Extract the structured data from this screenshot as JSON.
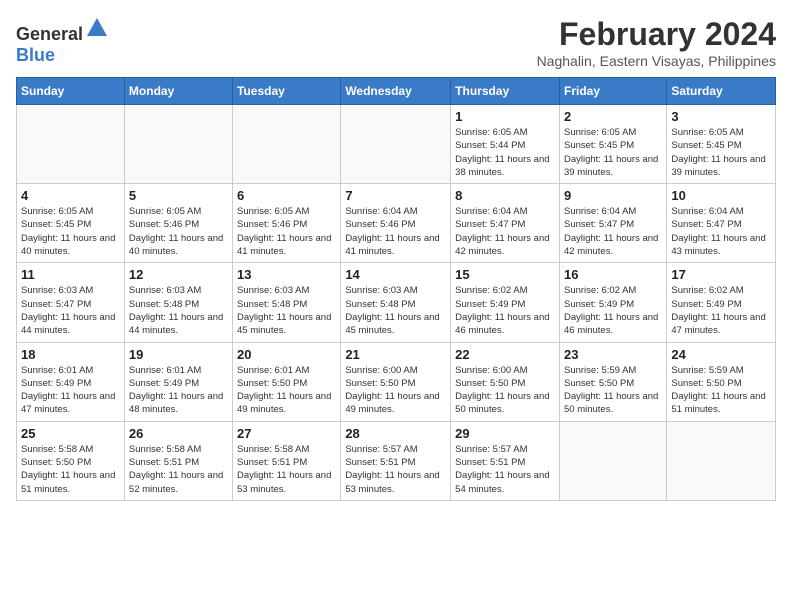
{
  "logo": {
    "text_general": "General",
    "text_blue": "Blue"
  },
  "title": {
    "month_year": "February 2024",
    "location": "Naghalin, Eastern Visayas, Philippines"
  },
  "weekdays": [
    "Sunday",
    "Monday",
    "Tuesday",
    "Wednesday",
    "Thursday",
    "Friday",
    "Saturday"
  ],
  "weeks": [
    [
      {
        "day": "",
        "sunrise": "",
        "sunset": "",
        "daylight": "",
        "empty": true
      },
      {
        "day": "",
        "sunrise": "",
        "sunset": "",
        "daylight": "",
        "empty": true
      },
      {
        "day": "",
        "sunrise": "",
        "sunset": "",
        "daylight": "",
        "empty": true
      },
      {
        "day": "",
        "sunrise": "",
        "sunset": "",
        "daylight": "",
        "empty": true
      },
      {
        "day": "1",
        "sunrise": "Sunrise: 6:05 AM",
        "sunset": "Sunset: 5:44 PM",
        "daylight": "Daylight: 11 hours and 38 minutes."
      },
      {
        "day": "2",
        "sunrise": "Sunrise: 6:05 AM",
        "sunset": "Sunset: 5:45 PM",
        "daylight": "Daylight: 11 hours and 39 minutes."
      },
      {
        "day": "3",
        "sunrise": "Sunrise: 6:05 AM",
        "sunset": "Sunset: 5:45 PM",
        "daylight": "Daylight: 11 hours and 39 minutes."
      }
    ],
    [
      {
        "day": "4",
        "sunrise": "Sunrise: 6:05 AM",
        "sunset": "Sunset: 5:45 PM",
        "daylight": "Daylight: 11 hours and 40 minutes."
      },
      {
        "day": "5",
        "sunrise": "Sunrise: 6:05 AM",
        "sunset": "Sunset: 5:46 PM",
        "daylight": "Daylight: 11 hours and 40 minutes."
      },
      {
        "day": "6",
        "sunrise": "Sunrise: 6:05 AM",
        "sunset": "Sunset: 5:46 PM",
        "daylight": "Daylight: 11 hours and 41 minutes."
      },
      {
        "day": "7",
        "sunrise": "Sunrise: 6:04 AM",
        "sunset": "Sunset: 5:46 PM",
        "daylight": "Daylight: 11 hours and 41 minutes."
      },
      {
        "day": "8",
        "sunrise": "Sunrise: 6:04 AM",
        "sunset": "Sunset: 5:47 PM",
        "daylight": "Daylight: 11 hours and 42 minutes."
      },
      {
        "day": "9",
        "sunrise": "Sunrise: 6:04 AM",
        "sunset": "Sunset: 5:47 PM",
        "daylight": "Daylight: 11 hours and 42 minutes."
      },
      {
        "day": "10",
        "sunrise": "Sunrise: 6:04 AM",
        "sunset": "Sunset: 5:47 PM",
        "daylight": "Daylight: 11 hours and 43 minutes."
      }
    ],
    [
      {
        "day": "11",
        "sunrise": "Sunrise: 6:03 AM",
        "sunset": "Sunset: 5:47 PM",
        "daylight": "Daylight: 11 hours and 44 minutes."
      },
      {
        "day": "12",
        "sunrise": "Sunrise: 6:03 AM",
        "sunset": "Sunset: 5:48 PM",
        "daylight": "Daylight: 11 hours and 44 minutes."
      },
      {
        "day": "13",
        "sunrise": "Sunrise: 6:03 AM",
        "sunset": "Sunset: 5:48 PM",
        "daylight": "Daylight: 11 hours and 45 minutes."
      },
      {
        "day": "14",
        "sunrise": "Sunrise: 6:03 AM",
        "sunset": "Sunset: 5:48 PM",
        "daylight": "Daylight: 11 hours and 45 minutes."
      },
      {
        "day": "15",
        "sunrise": "Sunrise: 6:02 AM",
        "sunset": "Sunset: 5:49 PM",
        "daylight": "Daylight: 11 hours and 46 minutes."
      },
      {
        "day": "16",
        "sunrise": "Sunrise: 6:02 AM",
        "sunset": "Sunset: 5:49 PM",
        "daylight": "Daylight: 11 hours and 46 minutes."
      },
      {
        "day": "17",
        "sunrise": "Sunrise: 6:02 AM",
        "sunset": "Sunset: 5:49 PM",
        "daylight": "Daylight: 11 hours and 47 minutes."
      }
    ],
    [
      {
        "day": "18",
        "sunrise": "Sunrise: 6:01 AM",
        "sunset": "Sunset: 5:49 PM",
        "daylight": "Daylight: 11 hours and 47 minutes."
      },
      {
        "day": "19",
        "sunrise": "Sunrise: 6:01 AM",
        "sunset": "Sunset: 5:49 PM",
        "daylight": "Daylight: 11 hours and 48 minutes."
      },
      {
        "day": "20",
        "sunrise": "Sunrise: 6:01 AM",
        "sunset": "Sunset: 5:50 PM",
        "daylight": "Daylight: 11 hours and 49 minutes."
      },
      {
        "day": "21",
        "sunrise": "Sunrise: 6:00 AM",
        "sunset": "Sunset: 5:50 PM",
        "daylight": "Daylight: 11 hours and 49 minutes."
      },
      {
        "day": "22",
        "sunrise": "Sunrise: 6:00 AM",
        "sunset": "Sunset: 5:50 PM",
        "daylight": "Daylight: 11 hours and 50 minutes."
      },
      {
        "day": "23",
        "sunrise": "Sunrise: 5:59 AM",
        "sunset": "Sunset: 5:50 PM",
        "daylight": "Daylight: 11 hours and 50 minutes."
      },
      {
        "day": "24",
        "sunrise": "Sunrise: 5:59 AM",
        "sunset": "Sunset: 5:50 PM",
        "daylight": "Daylight: 11 hours and 51 minutes."
      }
    ],
    [
      {
        "day": "25",
        "sunrise": "Sunrise: 5:58 AM",
        "sunset": "Sunset: 5:50 PM",
        "daylight": "Daylight: 11 hours and 51 minutes."
      },
      {
        "day": "26",
        "sunrise": "Sunrise: 5:58 AM",
        "sunset": "Sunset: 5:51 PM",
        "daylight": "Daylight: 11 hours and 52 minutes."
      },
      {
        "day": "27",
        "sunrise": "Sunrise: 5:58 AM",
        "sunset": "Sunset: 5:51 PM",
        "daylight": "Daylight: 11 hours and 53 minutes."
      },
      {
        "day": "28",
        "sunrise": "Sunrise: 5:57 AM",
        "sunset": "Sunset: 5:51 PM",
        "daylight": "Daylight: 11 hours and 53 minutes."
      },
      {
        "day": "29",
        "sunrise": "Sunrise: 5:57 AM",
        "sunset": "Sunset: 5:51 PM",
        "daylight": "Daylight: 11 hours and 54 minutes."
      },
      {
        "day": "",
        "sunrise": "",
        "sunset": "",
        "daylight": "",
        "empty": true
      },
      {
        "day": "",
        "sunrise": "",
        "sunset": "",
        "daylight": "",
        "empty": true
      }
    ]
  ]
}
